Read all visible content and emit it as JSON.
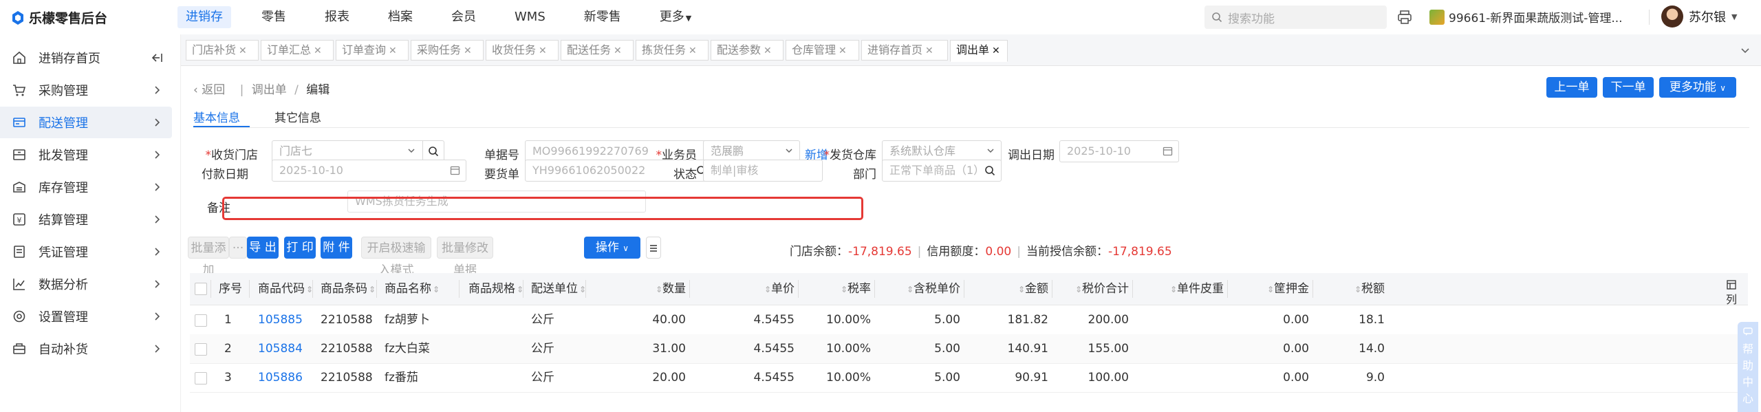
{
  "app": {
    "title": "乐檬零售后台"
  },
  "topnav": {
    "items": [
      "进销存",
      "零售",
      "报表",
      "档案",
      "会员",
      "WMS",
      "新零售",
      "更多"
    ],
    "active": "进销存"
  },
  "search": {
    "placeholder": "搜索功能"
  },
  "store": {
    "name": "99661-新界面果蔬版测试-管理..."
  },
  "user": {
    "name": "苏尔银"
  },
  "sidebar": {
    "items": [
      {
        "label": "进销存首页",
        "icon": "home-icon"
      },
      {
        "label": "采购管理",
        "icon": "cart-icon"
      },
      {
        "label": "配送管理",
        "icon": "delivery-icon"
      },
      {
        "label": "批发管理",
        "icon": "wholesale-icon"
      },
      {
        "label": "库存管理",
        "icon": "inventory-icon"
      },
      {
        "label": "结算管理",
        "icon": "settlement-icon"
      },
      {
        "label": "凭证管理",
        "icon": "voucher-icon"
      },
      {
        "label": "数据分析",
        "icon": "chart-icon"
      },
      {
        "label": "设置管理",
        "icon": "settings-icon"
      },
      {
        "label": "自动补货",
        "icon": "replenish-icon"
      }
    ],
    "active": "配送管理"
  },
  "tabs": [
    "门店补货",
    "订单汇总",
    "订单查询",
    "采购任务",
    "收货任务",
    "配送任务",
    "拣货任务",
    "配送参数",
    "仓库管理",
    "进销存首页",
    "调出单"
  ],
  "active_tab": "调出单",
  "breadcrumb": {
    "back": "返回",
    "parent": "调出单",
    "current": "编辑"
  },
  "header_buttons": {
    "prev": "上一单",
    "next": "下一单",
    "more": "更多功能"
  },
  "subtabs": {
    "basic": "基本信息",
    "other": "其它信息"
  },
  "form": {
    "receive_store": {
      "label": "收货门店",
      "value": "门店七"
    },
    "doc_no": {
      "label": "单据号",
      "value": "MO99661992270769"
    },
    "salesman": {
      "label": "业务员",
      "value": "范展鹏",
      "add": "新增"
    },
    "ship_warehouse": {
      "label": "发货仓库",
      "value": "系统默认仓库"
    },
    "out_date": {
      "label": "调出日期",
      "value": "2025-10-10"
    },
    "pay_date": {
      "label": "付款日期",
      "value": "2025-10-10"
    },
    "request_doc": {
      "label": "要货单",
      "value": "YH99661062050022"
    },
    "status": {
      "label": "状态",
      "value": "制单|审核"
    },
    "department": {
      "label": "部门",
      "value": "正常下单商品（1）"
    },
    "remark": {
      "label": "备注",
      "value": "WMS拣货任务生成"
    }
  },
  "toolbar": {
    "batch_add": "批量添加",
    "more": "···",
    "export": "导 出",
    "print": "打 印",
    "attach": "附 件",
    "quick_input": "开启极速输入模式",
    "batch_edit": "批量修改单据",
    "operate": "操作"
  },
  "balance": {
    "store_balance_label": "门店余额：",
    "store_balance": "-17,819.65",
    "credit_label": "信用额度：",
    "credit": "0.00",
    "current_credit_label": "当前授信余额：",
    "current_credit": "-17,819.65"
  },
  "table": {
    "headers": [
      "序号",
      "商品代码",
      "商品条码",
      "商品名称",
      "商品规格",
      "配送单位",
      "数量",
      "单价",
      "税率",
      "含税单价",
      "金额",
      "税价合计",
      "单件皮重",
      "筐押金",
      "税额"
    ],
    "rows": [
      {
        "no": "1",
        "code": "105885",
        "barcode": "2210588",
        "name": "fz胡萝卜",
        "spec": "",
        "unit": "公斤",
        "qty": "40.00",
        "price": "4.5455",
        "tax": "10.00%",
        "tax_price": "5.00",
        "amount": "181.82",
        "total": "200.00",
        "tare": "",
        "deposit": "0.00",
        "tax_amt": "18.1"
      },
      {
        "no": "2",
        "code": "105884",
        "barcode": "2210588",
        "name": "fz大白菜",
        "spec": "",
        "unit": "公斤",
        "qty": "31.00",
        "price": "4.5455",
        "tax": "10.00%",
        "tax_price": "5.00",
        "amount": "140.91",
        "total": "155.00",
        "tare": "",
        "deposit": "0.00",
        "tax_amt": "14.0"
      },
      {
        "no": "3",
        "code": "105886",
        "barcode": "2210588",
        "name": "fz番茄",
        "spec": "",
        "unit": "公斤",
        "qty": "20.00",
        "price": "4.5455",
        "tax": "10.00%",
        "tax_price": "5.00",
        "amount": "90.91",
        "total": "100.00",
        "tare": "",
        "deposit": "0.00",
        "tax_amt": "9.0"
      }
    ]
  },
  "side_tools": {
    "columns": "列",
    "help": "帮助中心"
  }
}
